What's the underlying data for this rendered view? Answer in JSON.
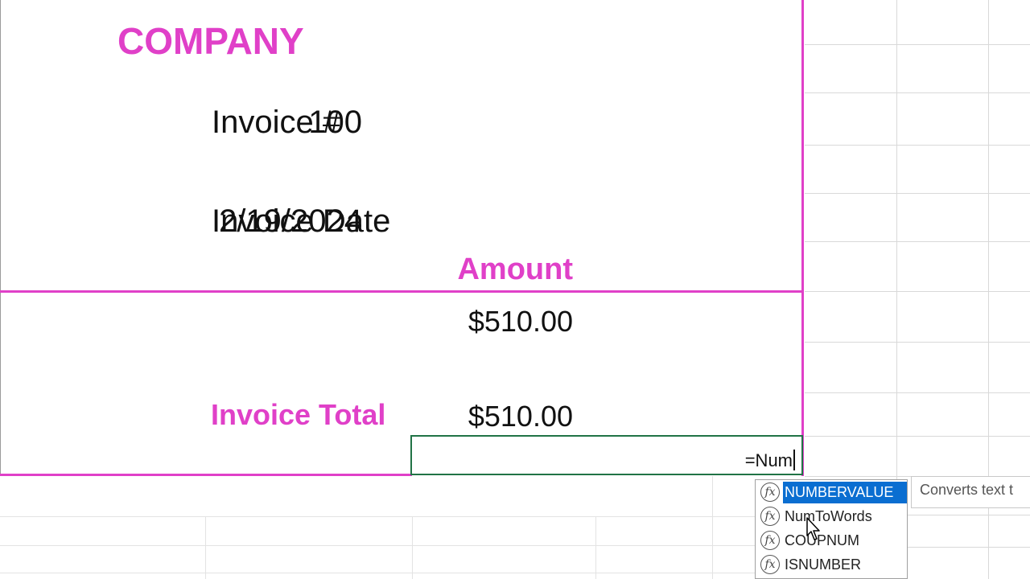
{
  "invoice": {
    "company": "COMPANY",
    "invoice_number_label": "Invoice #",
    "invoice_number_value": "100",
    "invoice_date_label": "Invoice Date",
    "invoice_date_value": "2/19/2024",
    "amount_header": "Amount",
    "line_amount": "$510.00",
    "total_label": "Invoice Total",
    "total_value": "$510.00"
  },
  "active_cell": {
    "formula": "=Num"
  },
  "autocomplete": {
    "icon": "fx-icon",
    "items": [
      {
        "label": "NUMBERVALUE",
        "selected": true
      },
      {
        "label": "NumToWords",
        "selected": false
      },
      {
        "label": "COUPNUM",
        "selected": false
      },
      {
        "label": "ISNUMBER",
        "selected": false
      }
    ]
  },
  "tooltip": {
    "text": "Converts text t"
  },
  "colors": {
    "accent": "#e040c8",
    "active_cell_border": "#217346",
    "selection": "#0a6ed1"
  }
}
